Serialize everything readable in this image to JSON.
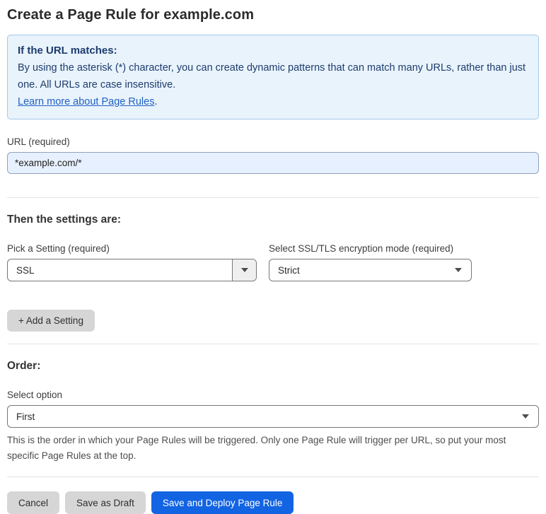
{
  "page": {
    "title": "Create a Page Rule for example.com"
  },
  "info_box": {
    "heading": "If the URL matches:",
    "body": "By using the asterisk (*) character, you can create dynamic patterns that can match many URLs, rather than just one. All URLs are case insensitive.",
    "link_label": "Learn more about Page Rules",
    "link_suffix": "."
  },
  "url_field": {
    "label": "URL (required)",
    "value": "*example.com/*"
  },
  "settings": {
    "heading": "Then the settings are:",
    "pick_setting": {
      "label": "Pick a Setting (required)",
      "selected_value": "SSL"
    },
    "ssl_mode": {
      "label": "Select SSL/TLS encryption mode (required)",
      "selected_value": "Strict"
    },
    "add_setting_label": "+ Add a Setting"
  },
  "order": {
    "heading": "Order:",
    "label": "Select option",
    "selected_value": "First",
    "help_text": "This is the order in which your Page Rules will be triggered. Only one Page Rule will trigger per URL, so put your most specific Page Rules at the top."
  },
  "footer": {
    "cancel_label": "Cancel",
    "save_draft_label": "Save as Draft",
    "save_deploy_label": "Save and Deploy Page Rule"
  },
  "colors": {
    "accent_blue": "#1264e3",
    "info_bg": "#e9f3fc",
    "info_border": "#a3c9e9",
    "info_text": "#1d3c6d",
    "link_blue": "#2161c4",
    "input_fill": "#e7f0fe",
    "button_gray": "#d6d6d6",
    "divider": "#e3e3e3"
  }
}
